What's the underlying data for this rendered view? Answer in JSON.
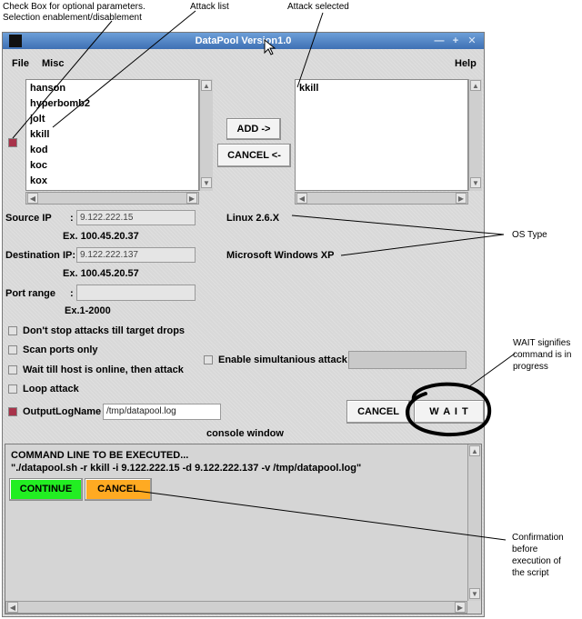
{
  "annotations": {
    "checkbox_note_line1": "Check Box for optional parameters.",
    "checkbox_note_line2": "Selection enablement/disablement",
    "attack_list": "Attack list",
    "attack_selected": "Attack selected",
    "os_type": "OS Type",
    "wait_note_line1": "WAIT signifies",
    "wait_note_line2": "command is in",
    "wait_note_line3": "progress",
    "confirm_line1": "Confirmation",
    "confirm_line2": "before",
    "confirm_line3": "execution of",
    "confirm_line4": "the script"
  },
  "window": {
    "title": "DataPool Version1.0"
  },
  "menu": {
    "file": "File",
    "misc": "Misc",
    "help": "Help"
  },
  "attack_list": {
    "items": [
      "hanson",
      "hyperbomb2",
      "jolt",
      "kkill",
      "kod",
      "koc",
      "kox"
    ]
  },
  "selected_list": {
    "items": [
      "kkill"
    ]
  },
  "buttons": {
    "add": "ADD ->",
    "cancel_remove": "CANCEL <-",
    "cancel": "CANCEL",
    "wait": "W A I T",
    "continue": "CONTINUE",
    "console_cancel": "CANCEL"
  },
  "source_ip": {
    "label": "Source IP",
    "colon": ":",
    "value": "9.122.222.15",
    "example": "Ex. 100.45.20.37"
  },
  "destination_ip": {
    "label": "Destination IP:",
    "value": "9.122.222.137",
    "example": "Ex. 100.45.20.57"
  },
  "port_range": {
    "label": "Port range",
    "colon": ":",
    "value": "",
    "example": "Ex.1-2000"
  },
  "os": {
    "source": "Linux 2.6.X",
    "destination": "Microsoft Windows XP"
  },
  "options": {
    "dont_stop": "Don't stop attacks till target drops",
    "scan_ports": "Scan ports only",
    "wait_online": "Wait till host is online, then attack",
    "loop": "Loop attack",
    "output_log": "OutputLogName",
    "output_log_value": "/tmp/datapool.log",
    "simultaneous": "Enable simultanious attack",
    "simultaneous_value": ""
  },
  "console": {
    "title": "console window",
    "heading": "COMMAND LINE TO BE EXECUTED...",
    "command": "\"./datapool.sh -r kkill -i 9.122.222.15 -d 9.122.222.137 -v /tmp/datapool.log\""
  },
  "colors": {
    "title_bar": "#4a7cc0",
    "checked": "#a8334a",
    "continue": "#22ee22",
    "console_cancel": "#ffaa22"
  }
}
